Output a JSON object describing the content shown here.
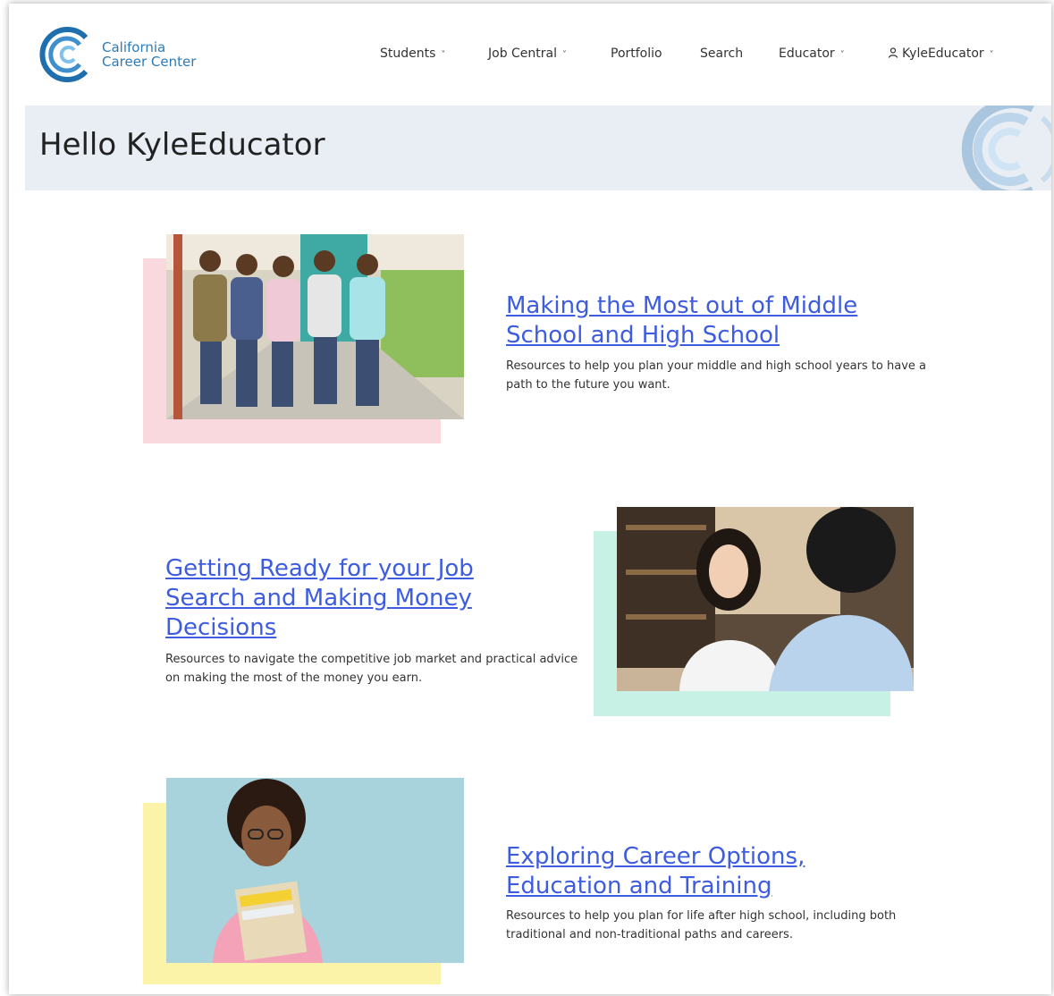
{
  "brand": {
    "line1": "California",
    "line2": "Career Center"
  },
  "nav": {
    "students": "Students",
    "job_central": "Job Central",
    "portfolio": "Portfolio",
    "search": "Search",
    "educator": "Educator",
    "user": "KyleEducator",
    "chevron": "˅"
  },
  "hero": {
    "title": "Hello KyleEducator"
  },
  "cards": [
    {
      "title": "Making the Most out of Middle School and High School",
      "description": "Resources to help you plan your middle and high school years to have a path to the future you want.",
      "accent": "#f9d9dd"
    },
    {
      "title": "Getting Ready for your Job Search and Making Money Decisions",
      "description": "Resources to navigate the competitive job market and practical advice on making the most of the money you earn.",
      "accent": "#c8f1e6"
    },
    {
      "title": "Exploring Career Options, Education and Training",
      "description": "Resources to help you plan for life after high school, including both traditional and non-traditional paths and careers.",
      "accent": "#fbf3a8"
    }
  ],
  "colors": {
    "brand_blue": "#2e7bb8",
    "link": "#3d5ce0",
    "hero_bg": "#e8eef4"
  }
}
